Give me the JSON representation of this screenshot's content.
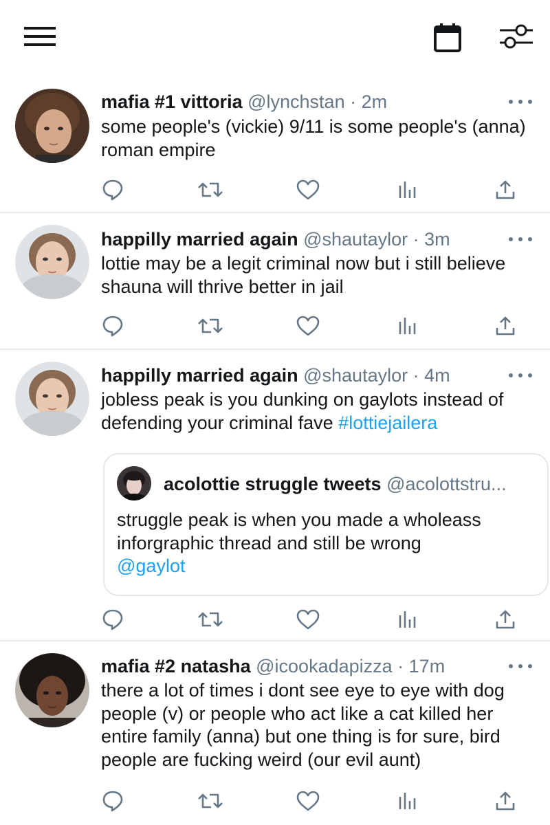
{
  "tweets": [
    {
      "name": "mafia #1 vittoria",
      "handle": "@lynchstan",
      "time": "· 2m",
      "text": "some people's (vickie) 9/11 is some people's (anna) roman empire"
    },
    {
      "name": "happilly married again",
      "handle": "@shautaylor",
      "time": "· 3m",
      "text": "lottie may be a legit criminal now but i still believe shauna will thrive better in jail"
    },
    {
      "name": "happilly married again",
      "handle": "@shautaylor",
      "time": "· 4m",
      "text": "jobless peak is you dunking on gaylots instead of defending your criminal fave ",
      "hashtag": "#lottiejailera",
      "quote": {
        "name": "acolottie struggle tweets",
        "handle": "@acolottstru...",
        "text": "struggle peak is when you made a wholeass inforgraphic thread and still be wrong",
        "mention": "@gaylot"
      }
    },
    {
      "name": "mafia #2 natasha",
      "handle": "@icookadapizza",
      "time": "· 17m",
      "text": "there a lot of times i dont see eye to eye with dog people (v) or people who act like a cat killed her entire family (anna) but one thing is for sure, bird people are fucking weird (our evil aunt)"
    }
  ],
  "icons": {
    "menu": "hamburger-menu-icon",
    "calendar": "calendar-icon",
    "filter": "sliders-icon",
    "reply": "reply-icon",
    "retweet": "retweet-icon",
    "like": "heart-icon",
    "analytics": "analytics-icon",
    "share": "share-icon",
    "more": "more-dots-icon"
  },
  "colors": {
    "link": "#1da1f2",
    "secondary": "#657786",
    "divider": "#e6ecf0"
  }
}
